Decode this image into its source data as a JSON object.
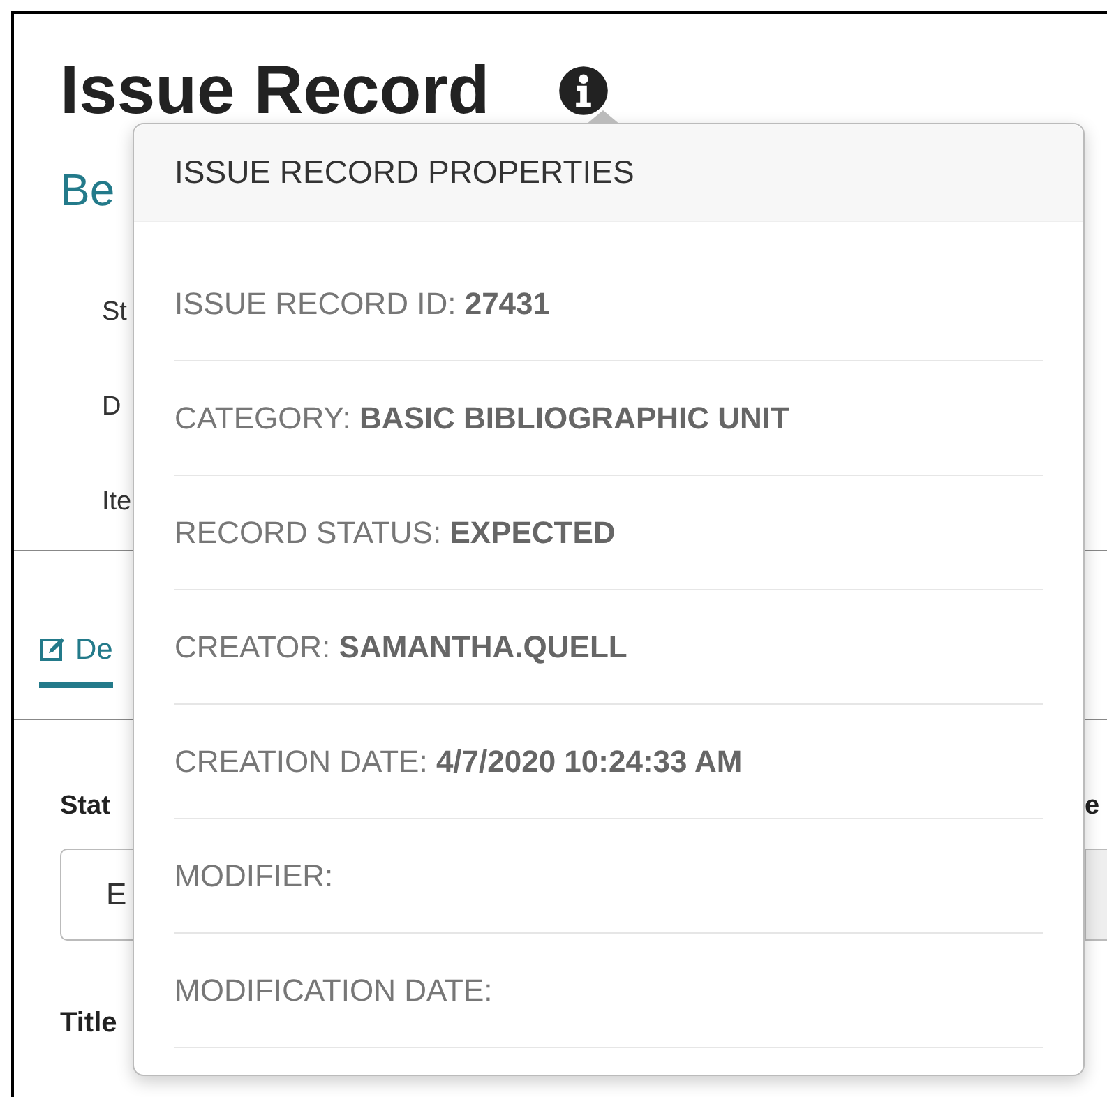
{
  "page": {
    "title": "Issue Record",
    "subtitle": "Be",
    "details": [
      "St",
      "D",
      "Ite"
    ],
    "tabs": [
      {
        "label": "De",
        "selected": true
      }
    ],
    "fields": [
      {
        "label": "Stat",
        "value": "E",
        "disabled": false
      },
      {
        "label": "e",
        "disabled": true
      }
    ],
    "next_label": "Title"
  },
  "popover": {
    "title": "ISSUE RECORD PROPERTIES",
    "rows": [
      {
        "label": "ISSUE RECORD ID:",
        "value": "27431"
      },
      {
        "label": "CATEGORY:",
        "value": "BASIC BIBLIOGRAPHIC UNIT"
      },
      {
        "label": "RECORD STATUS:",
        "value": "EXPECTED"
      },
      {
        "label": "CREATOR:",
        "value": "SAMANTHA.QUELL"
      },
      {
        "label": "CREATION DATE:",
        "value": "4/7/2020 10:24:33 AM"
      },
      {
        "label": "MODIFIER:"
      },
      {
        "label": "MODIFICATION DATE:"
      }
    ]
  }
}
